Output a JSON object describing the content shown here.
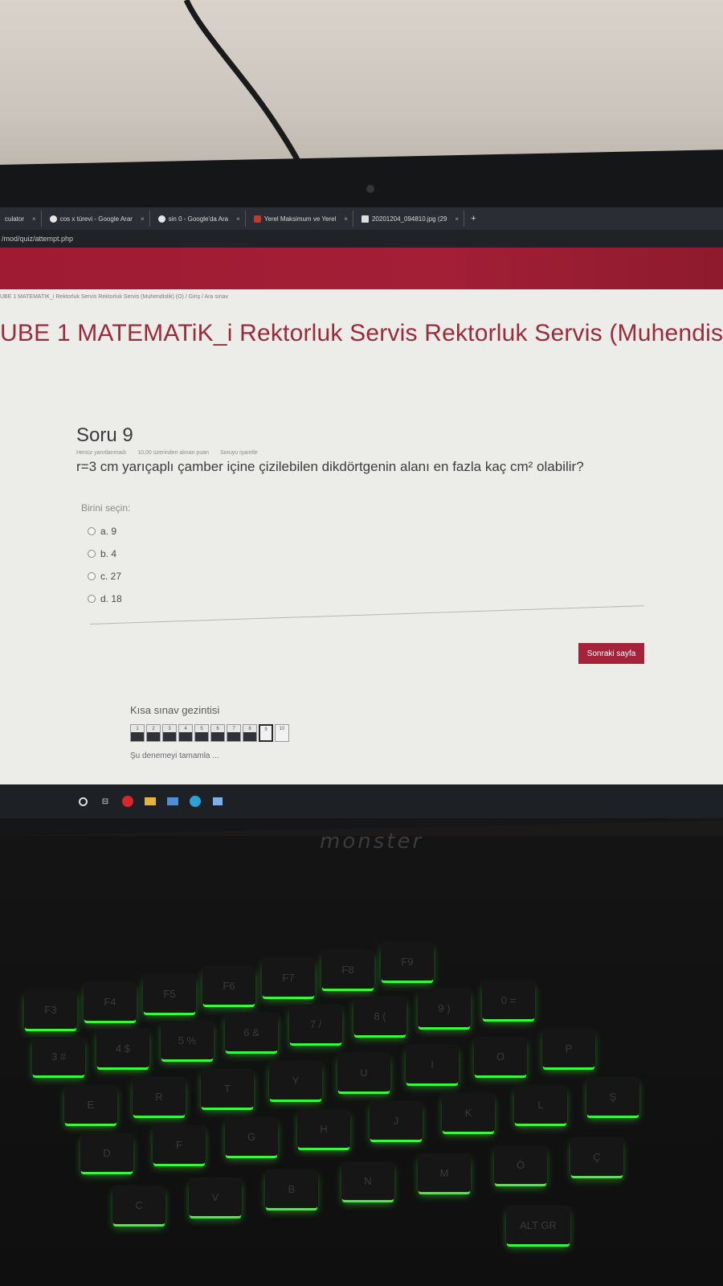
{
  "browser": {
    "tabs": [
      {
        "title": "culator",
        "icon": "calculator-icon"
      },
      {
        "title": "cos x türevi - Google Arar",
        "icon": "google-icon"
      },
      {
        "title": "sin 0 - Google'da Ara",
        "icon": "google-icon"
      },
      {
        "title": "Yerel Maksimum ve Yerel",
        "icon": "site-icon"
      },
      {
        "title": "20201204_094810.jpg (29",
        "icon": "file-icon"
      }
    ],
    "new_tab": "+",
    "url": "/mod/quiz/attempt.php"
  },
  "breadcrumb": "UBE 1 MATEMATIK_i Rektorluk Servis Rektorluk Servis (Muhendislik) (O) / Giriş / Ara sınav",
  "course_title": "UBE 1 MATEMATiK_i Rektorluk Servis Rektorluk Servis (Muhendis",
  "question": {
    "number": "Soru 9",
    "meta": [
      "Henüz yanıtlanmadı",
      "10,00 üzerinden alınan puan",
      "Soruyu işaretle"
    ],
    "text": "r=3 cm yarıçaplı çamber içine çizilebilen dikdörtgenin alanı en fazla kaç cm² olabilir?",
    "choose_label": "Birini seçin:",
    "options": [
      "a. 9",
      "b. 4",
      "c. 27",
      "d. 18"
    ]
  },
  "next_button": "Sonraki sayfa",
  "quiz_nav": {
    "title": "Kısa sınav gezintisi",
    "boxes": [
      "1",
      "2",
      "3",
      "4",
      "5",
      "6",
      "7",
      "8",
      "9",
      "10"
    ],
    "current_box": "9",
    "finish_link": "Şu denemeyi tamamla ..."
  },
  "taskbar": {
    "icons": [
      "search-icon",
      "task-view-icon",
      "opera-icon",
      "file-explorer-icon",
      "mail-icon",
      "edge-icon",
      "app-icon"
    ]
  },
  "laptop": {
    "brand": "monster",
    "keyboard_backlight": "#3cf63a",
    "keys": [
      "F3",
      "F4",
      "F5",
      "F6",
      "F7",
      "F8",
      "F9",
      "3 #",
      "4 $",
      "5 %",
      "6 &",
      "7 /",
      "8 (",
      "9 )",
      "0 =",
      "E",
      "R",
      "T",
      "Y",
      "U",
      "I",
      "O",
      "P",
      "D",
      "F",
      "G",
      "H",
      "J",
      "K",
      "L",
      "Ş",
      "C",
      "V",
      "B",
      "N",
      "M",
      "Ö",
      "Ç",
      "ALT GR"
    ]
  },
  "colors": {
    "accent": "#a3233a",
    "title_text": "#9a2b3b"
  }
}
